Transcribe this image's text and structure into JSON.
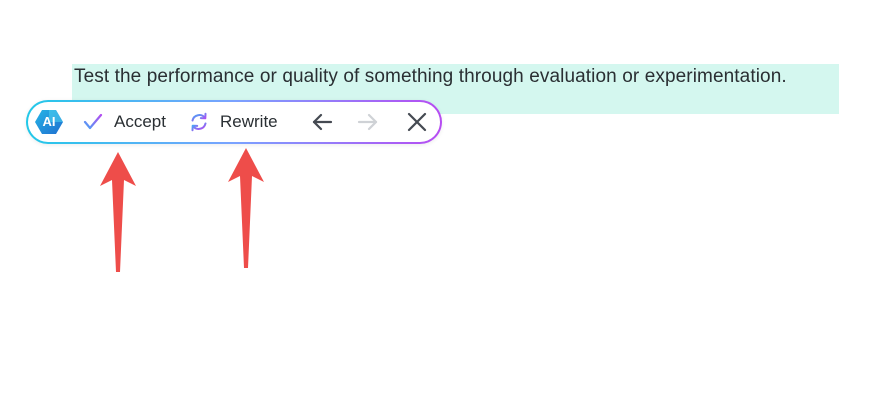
{
  "document": {
    "selected_text": "Test the performance or quality of something through evaluation or experimentation."
  },
  "toolbar": {
    "ai_badge_label": "AI",
    "accept_label": "Accept",
    "rewrite_label": "Rewrite",
    "icons": {
      "accept": "check-icon",
      "rewrite": "refresh-icon",
      "previous": "arrow-left-icon",
      "next": "arrow-right-icon",
      "close": "close-icon"
    },
    "next_disabled": true
  },
  "colors": {
    "selection_highlight": "#d4f7ef",
    "border_gradient_start": "#22c8e8",
    "border_gradient_end": "#b64cf2",
    "annotation_arrow": "#ee4d4a"
  }
}
